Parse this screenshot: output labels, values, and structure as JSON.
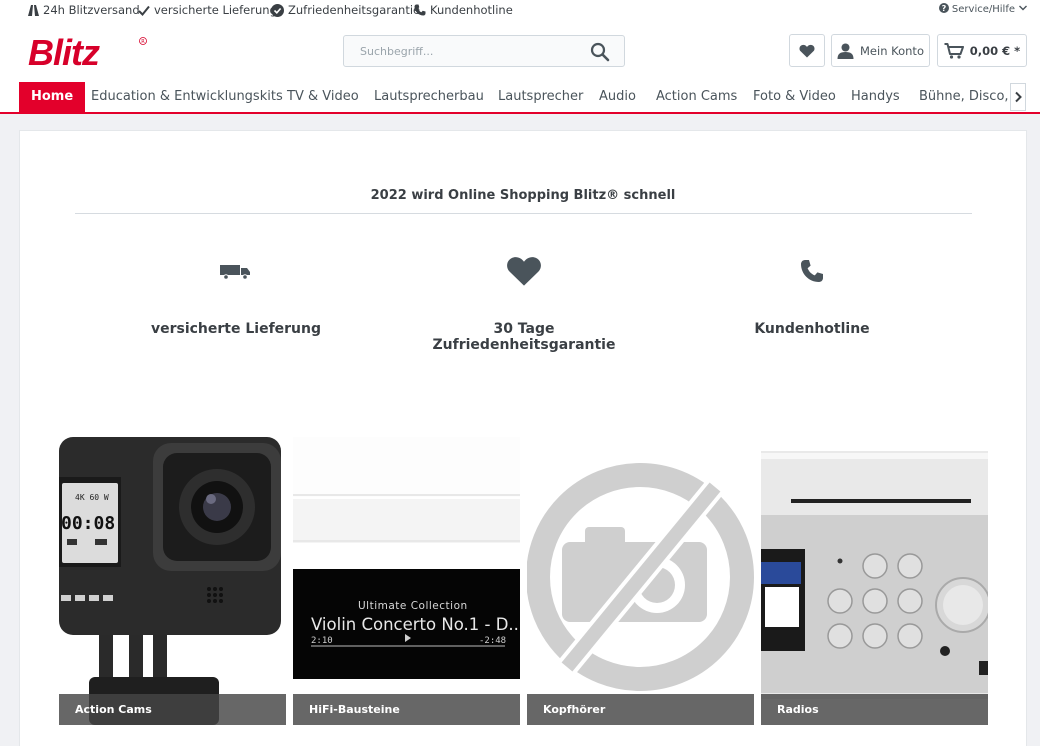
{
  "topbar": {
    "usps": [
      {
        "icon": "road-icon",
        "label": "24h Blitzversand"
      },
      {
        "icon": "check-icon",
        "label": "versicherte Lieferung"
      },
      {
        "icon": "check-circle-icon",
        "label": "Zufriedenheitsgarantie"
      },
      {
        "icon": "phone-icon",
        "label": "Kundenhotline"
      }
    ],
    "service_label": "Service/Hilfe"
  },
  "header": {
    "logo_text": "Blitz",
    "search_placeholder": "Suchbegriff...",
    "account_label": "Mein Konto",
    "cart_total": "0,00 € *"
  },
  "nav": {
    "items": [
      "Home",
      "Education & Entwicklungskits",
      "TV & Video",
      "Lautsprecherbau",
      "Lautsprecher",
      "Audio",
      "Action Cams",
      "Foto & Video",
      "Handys",
      "Bühne, Disco, Studio"
    ],
    "active": "Home"
  },
  "content": {
    "slogan": "2022 wird Online Shopping Blitz® schnell",
    "features": [
      {
        "icon": "truck-icon",
        "label": "versicherte Lieferung"
      },
      {
        "icon": "heart-icon",
        "label": "30 Tage Zufriedenheitsgarantie"
      },
      {
        "icon": "phone-icon",
        "label": "Kundenhotline"
      }
    ],
    "categories": [
      {
        "label": "Action Cams",
        "camera_rec": "4K 60 W",
        "camera_time": "00:08"
      },
      {
        "label": "HiFi-Bausteine",
        "display_title": "Ultimate Collection",
        "display_track": "Violin Concerto No.1 - D...",
        "display_elapsed": "2:10",
        "display_remaining": "-2:48"
      },
      {
        "label": "Kopfhörer"
      },
      {
        "label": "Radios"
      }
    ]
  },
  "colors": {
    "brand_red": "#e3002b",
    "text_dark": "#3a3f44",
    "caption_bg": "#4a4a4a"
  }
}
